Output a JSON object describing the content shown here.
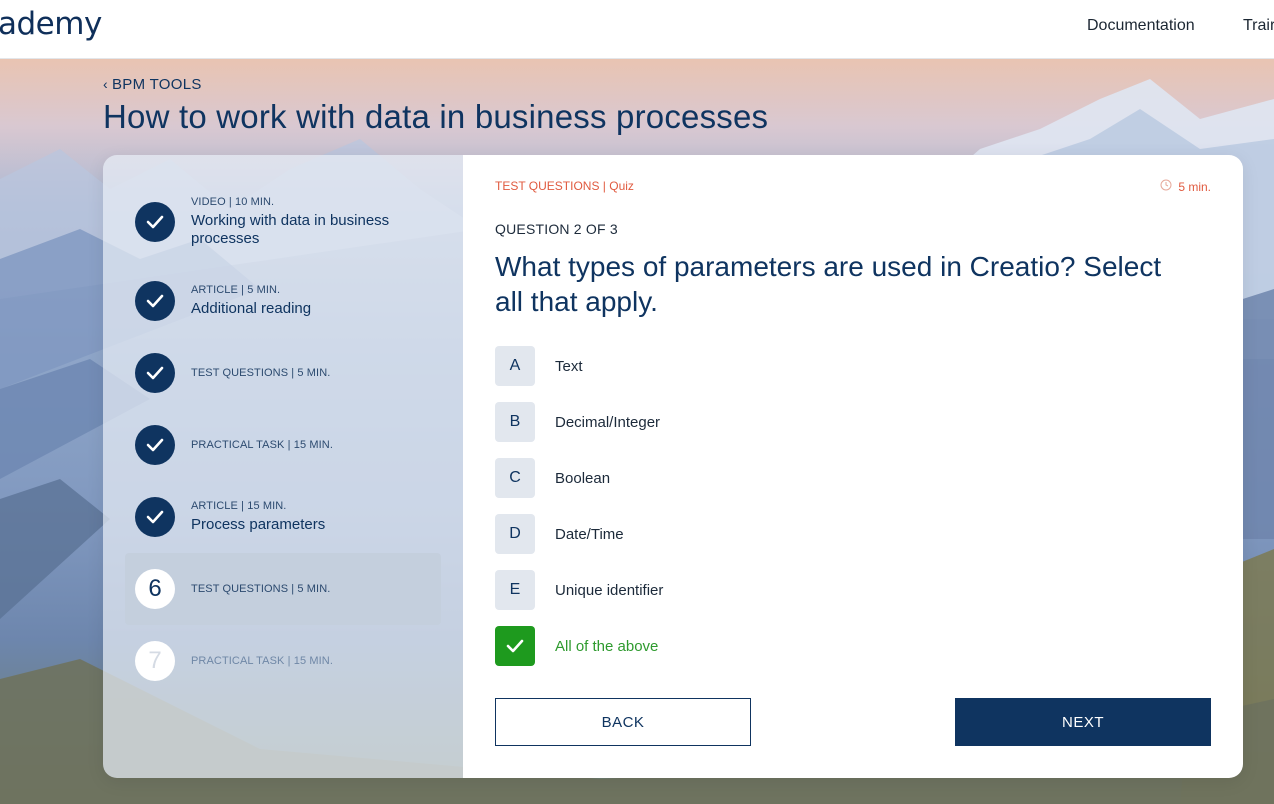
{
  "header": {
    "logo_text": "ademy",
    "nav": [
      {
        "label": "Documentation"
      },
      {
        "label": "Trair"
      }
    ]
  },
  "breadcrumb": {
    "label": "BPM TOOLS",
    "icon": "chevron-left-icon"
  },
  "page_title": "How to work with data in business processes",
  "steps": [
    {
      "status": "done",
      "meta": "VIDEO | 10 MIN.",
      "title": "Working with data in business processes"
    },
    {
      "status": "done",
      "meta": "ARTICLE | 5 MIN.",
      "title": "Additional reading"
    },
    {
      "status": "done",
      "meta": "TEST QUESTIONS | 5 MIN.",
      "title": ""
    },
    {
      "status": "done",
      "meta": "PRACTICAL TASK | 15 MIN.",
      "title": ""
    },
    {
      "status": "done",
      "meta": "ARTICLE | 15 MIN.",
      "title": "Process parameters"
    },
    {
      "status": "active",
      "number": "6",
      "meta": "TEST QUESTIONS | 5 MIN.",
      "title": ""
    },
    {
      "status": "pending",
      "number": "7",
      "meta": "PRACTICAL TASK | 15 MIN.",
      "title": ""
    }
  ],
  "quiz": {
    "category": "TEST QUESTIONS | Quiz",
    "duration": "5 min.",
    "counter": "QUESTION 2 OF 3",
    "question": "What types of parameters are used in Creatio? Select all that apply.",
    "options": [
      {
        "letter": "A",
        "label": "Text",
        "checked": false
      },
      {
        "letter": "B",
        "label": "Decimal/Integer",
        "checked": false
      },
      {
        "letter": "C",
        "label": "Boolean",
        "checked": false
      },
      {
        "letter": "D",
        "label": "Date/Time",
        "checked": false
      },
      {
        "letter": "E",
        "label": "Unique identifier",
        "checked": false
      },
      {
        "letter": "",
        "label": "All of the above",
        "checked": true
      }
    ]
  },
  "buttons": {
    "back": "BACK",
    "next": "NEXT"
  },
  "colors": {
    "primary": "#0f3460",
    "accent": "#e05a3f",
    "success": "#1e9a1e"
  }
}
